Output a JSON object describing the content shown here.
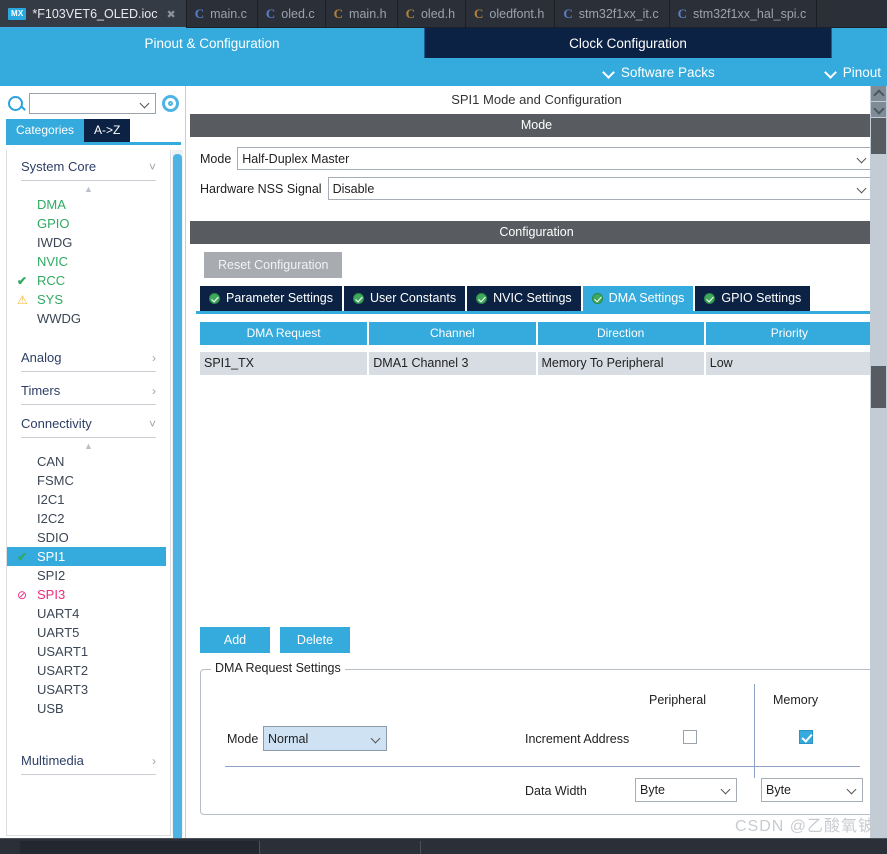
{
  "ide_tabs": [
    {
      "label": "*F103VET6_OLED.ioc",
      "icon": "mx-badge",
      "active": true,
      "closable": true
    },
    {
      "label": "main.c",
      "icon": "c-file-blue",
      "active": false
    },
    {
      "label": "oled.c",
      "icon": "c-file-blue",
      "active": false
    },
    {
      "label": "main.h",
      "icon": "c-file-amber",
      "active": false
    },
    {
      "label": "oled.h",
      "icon": "c-file-amber",
      "active": false
    },
    {
      "label": "oledfont.h",
      "icon": "c-file-amber",
      "active": false
    },
    {
      "label": "stm32f1xx_it.c",
      "icon": "c-file-blue",
      "active": false
    },
    {
      "label": "stm32f1xx_hal_spi.c",
      "icon": "c-file-blue",
      "active": false
    }
  ],
  "mx_tabs": {
    "pinout_configuration": "Pinout & Configuration",
    "clock_configuration": "Clock Configuration",
    "software_packs": "Software Packs",
    "pinout": "Pinout"
  },
  "sidebar": {
    "search_value": "",
    "search_placeholder": "",
    "tabs": [
      {
        "label": "Categories",
        "selected": true
      },
      {
        "label": "A->Z",
        "selected": false
      }
    ],
    "groups": [
      {
        "name": "System Core",
        "expanded": true,
        "arrow": "chevron-down",
        "items": [
          {
            "label": "DMA",
            "state": "configured",
            "mark": ""
          },
          {
            "label": "GPIO",
            "state": "configured",
            "mark": ""
          },
          {
            "label": "IWDG",
            "state": "default",
            "mark": ""
          },
          {
            "label": "NVIC",
            "state": "configured",
            "mark": ""
          },
          {
            "label": "RCC",
            "state": "configured",
            "mark": "check"
          },
          {
            "label": "SYS",
            "state": "configured",
            "mark": "warn"
          },
          {
            "label": "WWDG",
            "state": "default",
            "mark": ""
          }
        ]
      },
      {
        "name": "Analog",
        "expanded": false,
        "arrow": "chevron-right",
        "items": []
      },
      {
        "name": "Timers",
        "expanded": false,
        "arrow": "chevron-right",
        "items": []
      },
      {
        "name": "Connectivity",
        "expanded": true,
        "arrow": "chevron-down",
        "items": [
          {
            "label": "CAN",
            "state": "default",
            "mark": ""
          },
          {
            "label": "FSMC",
            "state": "default",
            "mark": ""
          },
          {
            "label": "I2C1",
            "state": "default",
            "mark": ""
          },
          {
            "label": "I2C2",
            "state": "default",
            "mark": ""
          },
          {
            "label": "SDIO",
            "state": "default",
            "mark": ""
          },
          {
            "label": "SPI1",
            "state": "selected",
            "mark": "check"
          },
          {
            "label": "SPI2",
            "state": "default",
            "mark": ""
          },
          {
            "label": "SPI3",
            "state": "error",
            "mark": "ban"
          },
          {
            "label": "UART4",
            "state": "default",
            "mark": ""
          },
          {
            "label": "UART5",
            "state": "default",
            "mark": ""
          },
          {
            "label": "USART1",
            "state": "default",
            "mark": ""
          },
          {
            "label": "USART2",
            "state": "default",
            "mark": ""
          },
          {
            "label": "USART3",
            "state": "default",
            "mark": ""
          },
          {
            "label": "USB",
            "state": "default",
            "mark": ""
          }
        ]
      },
      {
        "name": "Multimedia",
        "expanded": false,
        "arrow": "chevron-right",
        "items": []
      }
    ]
  },
  "main": {
    "panel_title": "SPI1 Mode and Configuration",
    "mode_section": {
      "header": "Mode",
      "fields": [
        {
          "label": "Mode",
          "value": "Half-Duplex Master"
        },
        {
          "label": "Hardware NSS Signal",
          "value": "Disable"
        }
      ]
    },
    "configuration_section": {
      "header": "Configuration",
      "reset_button": "Reset Configuration",
      "tabs": [
        {
          "label": "Parameter Settings",
          "selected": false
        },
        {
          "label": "User Constants",
          "selected": false
        },
        {
          "label": "NVIC Settings",
          "selected": false
        },
        {
          "label": "DMA Settings",
          "selected": true
        },
        {
          "label": "GPIO Settings",
          "selected": false
        }
      ],
      "dma_table": {
        "columns": [
          "DMA Request",
          "Channel",
          "Direction",
          "Priority"
        ],
        "rows": [
          [
            "SPI1_TX",
            "DMA1 Channel 3",
            "Memory To Peripheral",
            "Low"
          ]
        ]
      },
      "add_button": "Add",
      "delete_button": "Delete",
      "request_settings": {
        "legend": "DMA Request Settings",
        "peripheral_header": "Peripheral",
        "memory_header": "Memory",
        "mode_label": "Mode",
        "mode_value": "Normal",
        "increment_address_label": "Increment Address",
        "increment_address_peripheral": false,
        "increment_address_memory": true,
        "data_width_label": "Data Width",
        "data_width_peripheral": "Byte",
        "data_width_memory": "Byte"
      }
    }
  },
  "watermark": "CSDN @乙酸氧铍",
  "colors": {
    "accent_blue": "#35aadc",
    "dark_navy": "#0b2244",
    "header_gray": "#585c60",
    "ok_green": "#3faa5c",
    "warn_yellow": "#f0b429",
    "error_pink": "#ec2a7b",
    "row_gray": "#d7dde2"
  }
}
